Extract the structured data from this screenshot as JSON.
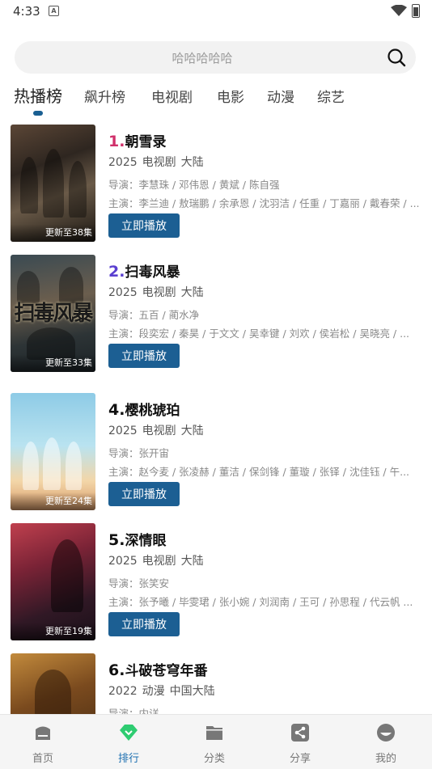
{
  "status_bar": {
    "time": "4:33",
    "notification_icon": "A"
  },
  "search": {
    "placeholder": "哈哈哈哈哈"
  },
  "tabs": [
    {
      "label": "热播榜",
      "active": true
    },
    {
      "label": "飙升榜"
    },
    {
      "label": "电视剧"
    },
    {
      "label": "电影"
    },
    {
      "label": "动漫"
    },
    {
      "label": "综艺"
    }
  ],
  "items": [
    {
      "rank": "1.",
      "title": "朝雪录",
      "rank_color": "#d0306a",
      "year": "2025",
      "type": "电视剧",
      "region": "大陆",
      "director": "导演：李慧珠 / 邓伟恩 / 黄斌 / 陈自强",
      "cast": "主演：李兰迪 / 敖瑞鹏 / 余承恩 / 沈羽洁 / 任重 / 丁嘉丽 / 戴春荣 / ...",
      "episode": "更新至38集",
      "play_label": "立即播放"
    },
    {
      "rank": "2.",
      "title": "扫毒风暴",
      "rank_color": "#5a3fd0",
      "year": "2025",
      "type": "电视剧",
      "region": "大陆",
      "director": "导演：五百 / 蔺水净",
      "cast": "主演：段奕宏 / 秦昊 / 于文文 / 吴幸键 / 刘欢 / 侯岩松 / 吴晓亮 / ...",
      "episode": "更新至33集",
      "play_label": "立即播放",
      "poster_text": "扫毒风暴"
    },
    {
      "rank": "4.",
      "title": "樱桃琥珀",
      "rank_color": "#222222",
      "year": "2025",
      "type": "电视剧",
      "region": "大陆",
      "director": "导演：张开宙",
      "cast": "主演：赵今麦 / 张凌赫 / 董洁 / 保剑锋 / 董璇 / 张铎 / 沈佳钰 / 午...",
      "episode": "更新至24集",
      "play_label": "立即播放"
    },
    {
      "rank": "5.",
      "title": "深情眼",
      "rank_color": "#222222",
      "year": "2025",
      "type": "电视剧",
      "region": "大陆",
      "director": "导演：张笑安",
      "cast": "主演：张予曦 / 毕雯珺 / 张小婉 / 刘润南 / 王可 / 孙思程 / 代云帆 ...",
      "episode": "更新至19集",
      "play_label": "立即播放"
    },
    {
      "rank": "6.",
      "title": "斗破苍穹年番",
      "rank_color": "#222222",
      "year": "2022",
      "type": "动漫",
      "region": "中国大陆",
      "director": "导演：内详"
    }
  ],
  "bottom_nav": [
    {
      "label": "首页",
      "icon": "home-icon"
    },
    {
      "label": "排行",
      "icon": "ranking-icon",
      "active": true
    },
    {
      "label": "分类",
      "icon": "folder-icon"
    },
    {
      "label": "分享",
      "icon": "share-icon"
    },
    {
      "label": "我的",
      "icon": "profile-icon"
    }
  ],
  "colors": {
    "accent": "#1c5f93",
    "nav_active": "#1c6fb0",
    "nav_active_icon": "#2ecc71"
  }
}
